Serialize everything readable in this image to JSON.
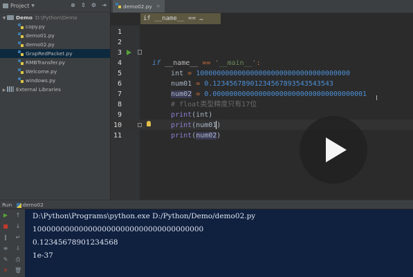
{
  "project_panel": {
    "title": "Project",
    "tree": [
      {
        "label": "Demo",
        "path": "D:\\Python\\Demo",
        "type": "folder",
        "expanded": true
      },
      {
        "label": "copy.py",
        "type": "file"
      },
      {
        "label": "demo01.py",
        "type": "file"
      },
      {
        "label": "demo02.py",
        "type": "file"
      },
      {
        "label": "GrapRedPacket.py",
        "type": "file",
        "selected": true
      },
      {
        "label": "RMBTransfer.py",
        "type": "file"
      },
      {
        "label": "Welcome.py",
        "type": "file"
      },
      {
        "label": "windows.py",
        "type": "file"
      },
      {
        "label": "External Libraries",
        "type": "libraries"
      }
    ]
  },
  "editor": {
    "tab_label": "demo02.py",
    "breadcrumb": "if __name__ == …",
    "line_numbers": [
      "1",
      "2",
      "3",
      "4",
      "5",
      "6",
      "7",
      "8",
      "9",
      "10",
      "11"
    ],
    "code": {
      "l3_if": "if",
      "l3_name": "__name__",
      "l3_eq": "==",
      "l3_main": "'__main__'",
      "l3_colon": ":",
      "l4_var": "int",
      "l4_eq": "=",
      "l4_val": "1000000000000000000000000000000000000",
      "l5_var": "num01",
      "l5_eq": "=",
      "l5_val": "0.12345678901234567893543543543",
      "l6_var": "num02",
      "l6_eq": "=",
      "l6_val": "0.0000000000000000000000000000000000001",
      "l7_comment": "# float类型精度只有17位",
      "l8_fn": "print",
      "l8_arg": "(int)",
      "l9_fn": "print",
      "l9_arg": "(num01)",
      "l10_fn": "print",
      "l10_open": "(",
      "l10_arg": "num02",
      "l10_close": ")"
    }
  },
  "run_panel": {
    "title": "Run",
    "config": "demo02",
    "output": [
      "D:\\Python\\Programs\\python.exe D:/Python/Demo/demo02.py",
      "1000000000000000000000000000000000000",
      "0.12345678901234568",
      "1e-37"
    ]
  }
}
